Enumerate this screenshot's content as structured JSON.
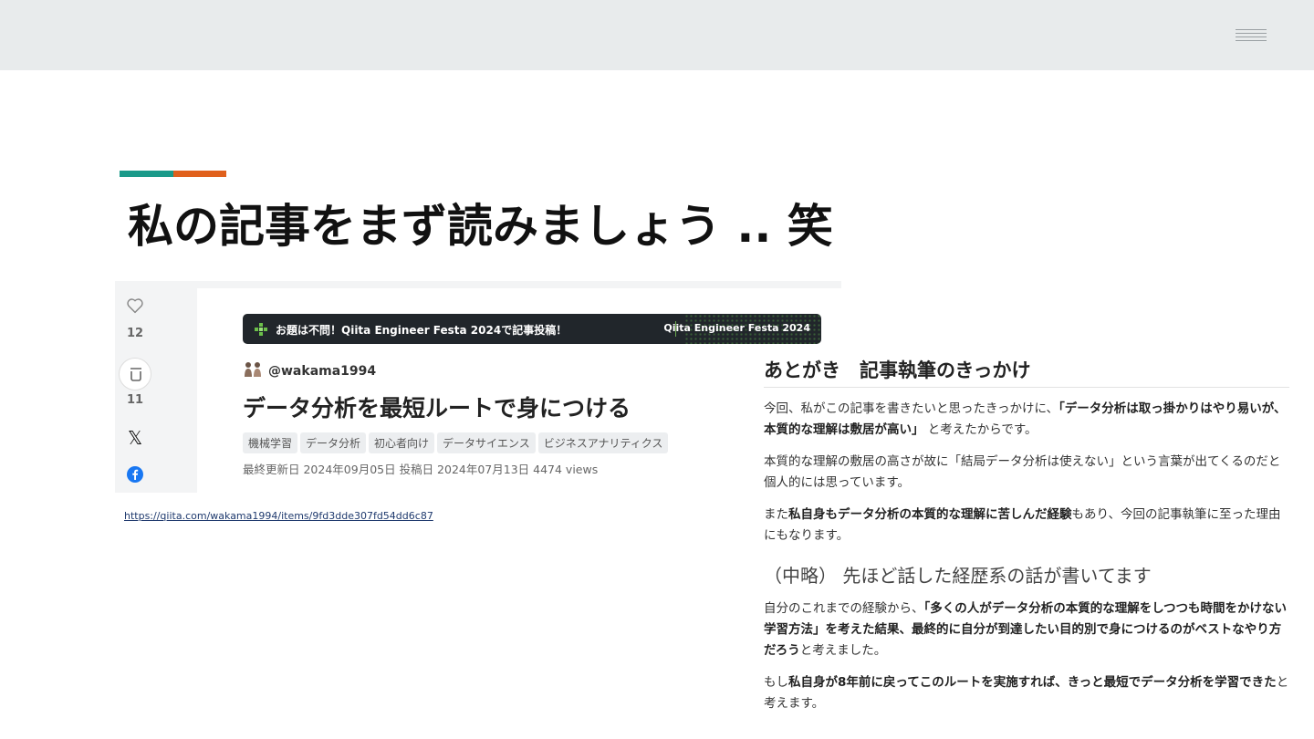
{
  "icons": {
    "menu": "hamburger-menu-icon"
  },
  "colors": {
    "topbar": "#e8ebec",
    "accent_teal": "#1a9a8a",
    "accent_orange": "#e0601c"
  },
  "slide": {
    "title": "私の記事をまず読みましょう .. 笑"
  },
  "article": {
    "likes": "12",
    "stocks": "11",
    "banner_left": "お題は不問！Qiita Engineer Festa 2024で記事投稿！",
    "banner_right": "Qiita Engineer Festa  2024",
    "author": "@wakama1994",
    "title": "データ分析を最短ルートで身につける",
    "tags": [
      "機械学習",
      "データ分析",
      "初心者向け",
      "データサイエンス",
      "ビジネスアナリティクス"
    ],
    "meta": "最終更新日 2024年09月05日  投稿日 2024年07月13日  4474 views"
  },
  "link": {
    "url": "https://qiita.com/wakama1994/items/9fd3dde307fd54dd6c87"
  },
  "excerpt": {
    "heading": "あとがき　記事執筆のきっかけ",
    "p1_a": "今回、私がこの記事を書きたいと思ったきっかけに、",
    "p1_b": "「データ分析は取っ掛かりはやり易いが、本質的な理解は敷居が高い」",
    "p1_c": " と考えたからです。",
    "p2": "本質的な理解の敷居の高さが故に「結局データ分析は使えない」という言葉が出てくるのだと個人的には思っています。",
    "p3_a": "また",
    "p3_b": "私自身もデータ分析の本質的な理解に苦しんだ経験",
    "p3_c": "もあり、今回の記事執筆に至った理由にもなります。",
    "subheading": "（中略） 先ほど話した経歴系の話が書いてます",
    "p4_a": "自分のこれまでの経験から、",
    "p4_b": "「多くの人がデータ分析の本質的な理解をしつつも時間をかけない学習方法」を考えた結果、最終的に自分が到達したい目的別で身につけるのがベストなやり方だろう",
    "p4_c": "と考えました。",
    "p5_a": "もし",
    "p5_b": "私自身が8年前に戻ってこのルートを実施すれば、きっと最短でデータ分析を学習できた",
    "p5_c": "と考えます。"
  }
}
